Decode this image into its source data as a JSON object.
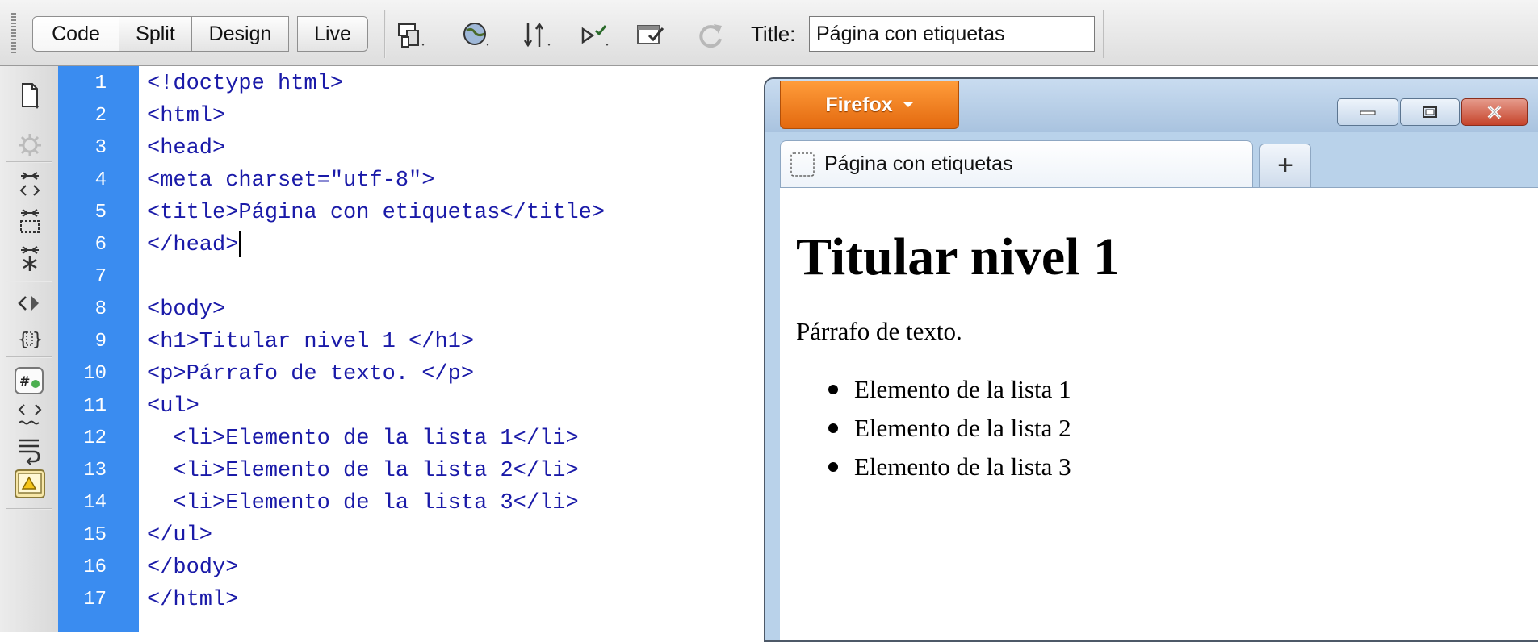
{
  "toolbar": {
    "views": [
      "Code",
      "Split",
      "Design"
    ],
    "live_label": "Live",
    "title_label": "Title:",
    "title_value": "Página con etiquetas"
  },
  "code": {
    "line_numbers": [
      "1",
      "2",
      "3",
      "4",
      "5",
      "6",
      "7",
      "8",
      "9",
      "10",
      "11",
      "12",
      "13",
      "14",
      "15",
      "16",
      "17"
    ],
    "lines": [
      "<!doctype html>",
      "<html>",
      "<head>",
      "<meta charset=\"utf-8\">",
      "<title>Página con etiquetas</title>",
      "</head>",
      "",
      "<body>",
      "<h1>Titular nivel 1 </h1>",
      "<p>Párrafo de texto. </p>",
      "<ul>",
      "  <li>Elemento de la lista 1</li>",
      "  <li>Elemento de la lista 2</li>",
      "  <li>Elemento de la lista 3</li>",
      "</ul>",
      "</body>",
      "</html>"
    ]
  },
  "browser": {
    "menu_button": "Firefox",
    "tab_title": "Página con etiquetas",
    "new_tab_label": "+",
    "page": {
      "heading": "Titular nivel 1",
      "paragraph": "Párrafo de texto.",
      "list_items": [
        "Elemento de la lista 1",
        "Elemento de la lista 2",
        "Elemento de la lista 3"
      ]
    }
  },
  "colors": {
    "gutter": "#3a8cf0",
    "tag_text": "#1a1aa8",
    "firefox_button": "#e3690f"
  }
}
